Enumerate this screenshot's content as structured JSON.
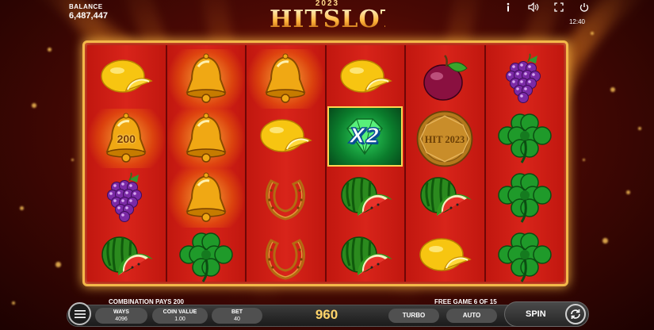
{
  "header": {
    "balance_label": "BALANCE",
    "balance_value": "6,487,447",
    "logo_year": "2023",
    "logo_text": "HITSLOT",
    "clock": "12:40",
    "icons": [
      "info-icon",
      "sound-icon",
      "fullscreen-icon",
      "close-icon"
    ]
  },
  "reels": [
    [
      "lemon",
      "bell",
      "grapes",
      "watermelon"
    ],
    [
      "bell",
      "bell",
      "bell",
      "clover"
    ],
    [
      "bell",
      "lemon",
      "horseshoe",
      "horseshoe"
    ],
    [
      "lemon",
      "wild",
      "watermelon",
      "watermelon"
    ],
    [
      "plum",
      "coin",
      "watermelon",
      "lemon"
    ],
    [
      "grapes",
      "clover",
      "clover",
      "clover"
    ]
  ],
  "winning_cells": [
    [
      0,
      1
    ],
    [
      1,
      0
    ],
    [
      1,
      1
    ],
    [
      1,
      2
    ],
    [
      2,
      0
    ]
  ],
  "win_label": "200",
  "wild": {
    "multiplier": "X2"
  },
  "coin_text": "HIT 2023",
  "footer": {
    "combination_message": "COMBINATION PAYS 200",
    "free_game_message": "FREE GAME 6 OF 15",
    "ways_label": "WAYS",
    "ways_value": "4096",
    "coin_value_label": "COIN VALUE",
    "coin_value": "1.00",
    "bet_label": "BET",
    "bet_value": "40",
    "win_amount": "960",
    "turbo_label": "TURBO",
    "auto_label": "AUTO",
    "spin_label": "SPIN"
  },
  "colors": {
    "frame_gold": "#f3b84a",
    "reel_red": "#c1170f",
    "win_gold": "#ffd46a",
    "wild_green": "#2ed45d"
  }
}
